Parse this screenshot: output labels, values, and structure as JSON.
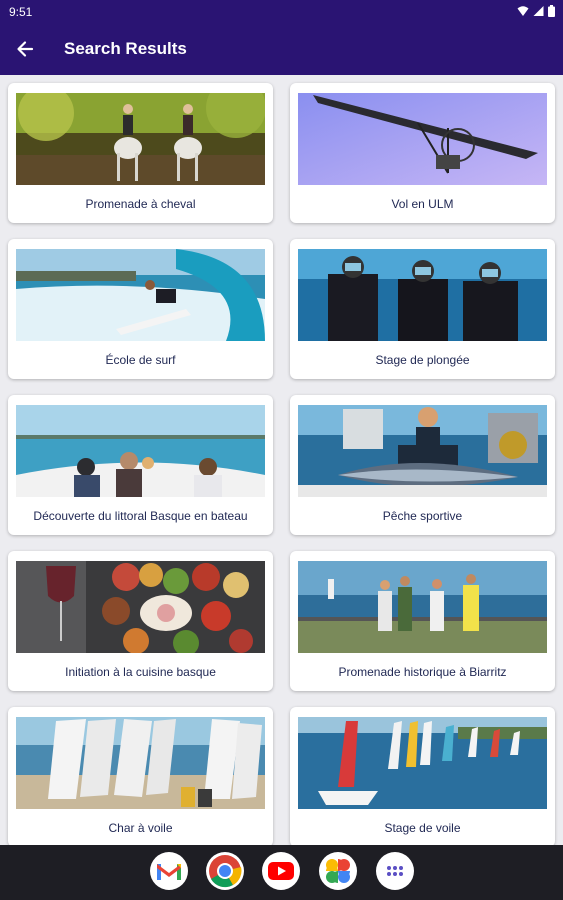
{
  "status_bar": {
    "time": "9:51"
  },
  "app_bar": {
    "title": "Search Results",
    "back_icon": "arrow-back-icon"
  },
  "results": [
    {
      "label": "Promenade à cheval",
      "image": "horse-riding"
    },
    {
      "label": "Vol en ULM",
      "image": "ultralight-flight"
    },
    {
      "label": "École de surf",
      "image": "surfing"
    },
    {
      "label": "Stage de plongée",
      "image": "scuba-diving"
    },
    {
      "label": "Découverte du littoral Basque en bateau",
      "image": "boat-coast"
    },
    {
      "label": "Pêche sportive",
      "image": "sport-fishing"
    },
    {
      "label": "Initiation à la cuisine basque",
      "image": "basque-food"
    },
    {
      "label": "Promenade historique à Biarritz",
      "image": "biarritz-walk"
    },
    {
      "label": "Char à voile",
      "image": "land-sailing"
    },
    {
      "label": "Stage de voile",
      "image": "sailing"
    }
  ],
  "dock": [
    "gmail-icon",
    "chrome-icon",
    "youtube-icon",
    "photos-icon",
    "app-drawer-icon"
  ],
  "colors": {
    "app_bar": "#2a1473",
    "card_text": "#222a55",
    "nav_bar": "#1e1e24"
  }
}
